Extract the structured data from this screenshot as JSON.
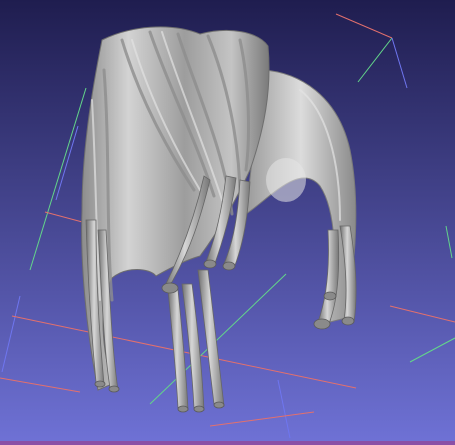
{
  "viewer": {
    "background_top": "#1f1d4f",
    "background_bottom": "#6f72d6",
    "mesh_color": "#c9c9c9",
    "axis_colors": {
      "x": "#e3706d",
      "y": "#63d68a",
      "z": "#6f76f0"
    },
    "status_strip_color": "#8a4fa6"
  },
  "model": {
    "kind": "hair-strands-mesh",
    "shading": "smooth-gray"
  }
}
